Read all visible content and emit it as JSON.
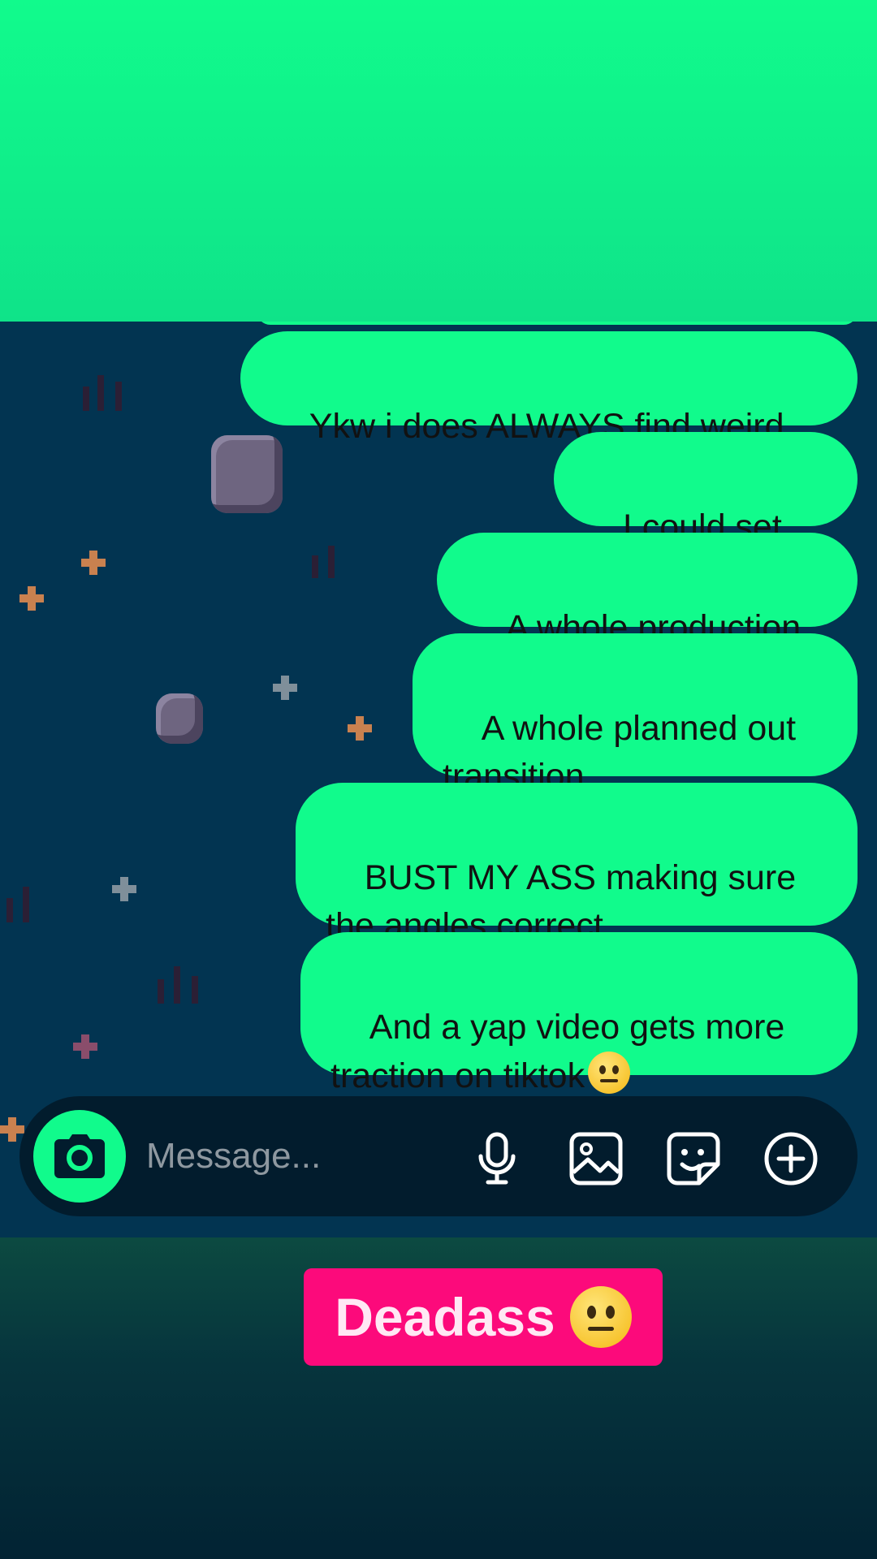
{
  "messages": [
    {
      "text": "Ykw i does ALWAYS find weird"
    },
    {
      "text": "I could set up"
    },
    {
      "text": "A whole production"
    },
    {
      "text": "A whole planned out\ntransition"
    },
    {
      "text": "BUST MY ASS making sure\nthe angles correct"
    },
    {
      "text": "And a yap video gets more\ntraction on tiktok",
      "emoji": "neutral-face"
    }
  ],
  "composer": {
    "placeholder": "Message...",
    "icons": [
      "camera-icon",
      "microphone-icon",
      "gallery-icon",
      "sticker-icon",
      "plus-icon"
    ]
  },
  "caption": {
    "text": "Deadass",
    "emoji": "neutral-face",
    "background_color": "#fc0a7b"
  },
  "colors": {
    "accent_green": "#11fb8c",
    "chat_background": "#023451"
  }
}
